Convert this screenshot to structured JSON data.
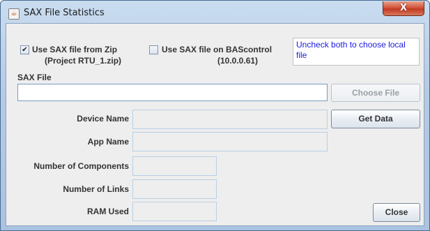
{
  "window": {
    "title": "SAX File Statistics",
    "close_glyph": "X",
    "title_icon": "java-cup-icon"
  },
  "options": {
    "zip": {
      "checked": true,
      "label": "Use SAX file from Zip",
      "detail": "(Project RTU_1.zip)"
    },
    "bascontrol": {
      "checked": false,
      "label": "Use SAX file on BAScontrol",
      "detail": "(10.0.0.61)"
    },
    "note": "Uncheck both to choose local file"
  },
  "sax_file": {
    "label": "SAX File",
    "value": ""
  },
  "buttons": {
    "choose_file": "Choose File",
    "get_data": "Get Data",
    "close": "Close"
  },
  "fields": [
    {
      "label": "Device Name",
      "value": ""
    },
    {
      "label": "App Name",
      "value": ""
    },
    {
      "label": "Number of Components",
      "value": ""
    },
    {
      "label": "Number of Links",
      "value": ""
    },
    {
      "label": "RAM Used",
      "value": ""
    }
  ],
  "colors": {
    "note_text": "#1a1ae0",
    "close_button": "#c23a22"
  }
}
